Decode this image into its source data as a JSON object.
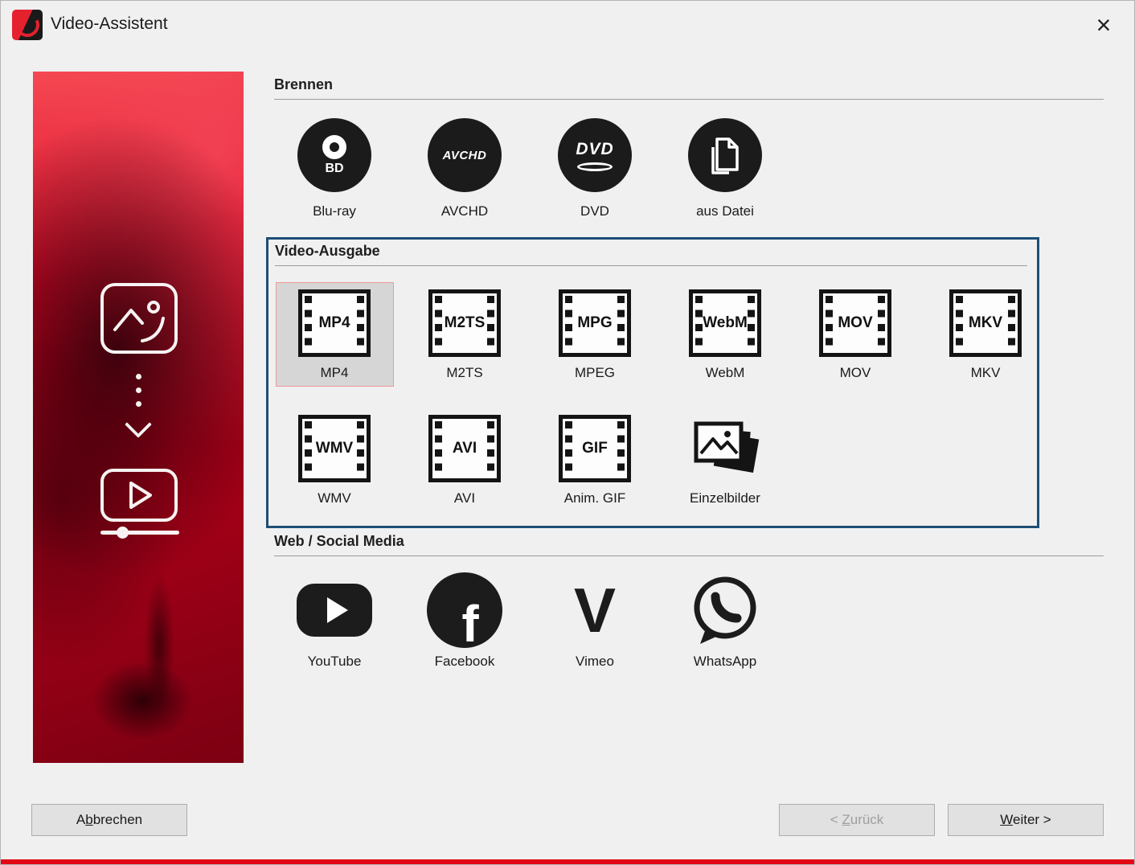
{
  "window": {
    "title": "Video-Assistent",
    "close_glyph": "×"
  },
  "brennen": {
    "title": "Brennen",
    "items": [
      {
        "label": "Blu-ray",
        "icon_text": "BD"
      },
      {
        "label": "AVCHD",
        "icon_text": "AVCHD"
      },
      {
        "label": "DVD",
        "icon_text": "DVD"
      },
      {
        "label": "aus Datei",
        "icon_text": ""
      }
    ]
  },
  "video_ausgabe": {
    "title": "Video-Ausgabe",
    "row1": [
      {
        "label": "MP4",
        "icon_text": "MP4",
        "selected": true
      },
      {
        "label": "M2TS",
        "icon_text": "M2TS",
        "selected": false
      },
      {
        "label": "MPEG",
        "icon_text": "MPG",
        "selected": false
      },
      {
        "label": "WebM",
        "icon_text": "WebM",
        "selected": false
      },
      {
        "label": "MOV",
        "icon_text": "MOV",
        "selected": false
      },
      {
        "label": "MKV",
        "icon_text": "MKV",
        "selected": false
      }
    ],
    "row2": [
      {
        "label": "WMV",
        "icon_text": "WMV",
        "selected": false
      },
      {
        "label": "AVI",
        "icon_text": "AVI",
        "selected": false
      },
      {
        "label": "Anim. GIF",
        "icon_text": "GIF",
        "selected": false
      },
      {
        "label": "Einzelbilder",
        "icon_text": "",
        "selected": false
      }
    ]
  },
  "web": {
    "title": "Web / Social Media",
    "items": [
      {
        "label": "YouTube"
      },
      {
        "label": "Facebook",
        "glyph": "f"
      },
      {
        "label": "Vimeo",
        "glyph": "V"
      },
      {
        "label": "WhatsApp"
      }
    ]
  },
  "footer": {
    "cancel": {
      "pre": "A",
      "key": "b",
      "post": "brechen"
    },
    "back": {
      "pre": "< ",
      "key": "Z",
      "post": "urück"
    },
    "next": {
      "pre": "",
      "key": "W",
      "post": "eiter >"
    }
  },
  "colors": {
    "accent_red": "#e30615",
    "selection_border": "#ef9a9a",
    "focus_box_border": "#1d4e75",
    "icon_black": "#1b1b1b"
  }
}
